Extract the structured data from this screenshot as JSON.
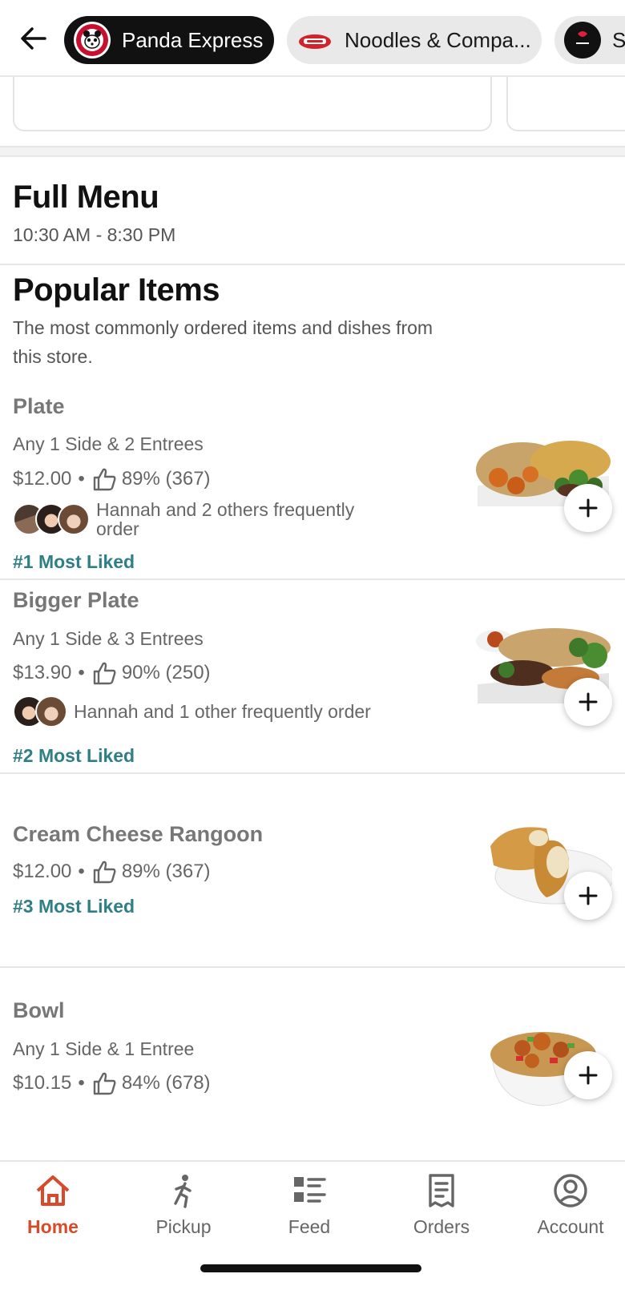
{
  "header": {
    "stores": [
      {
        "name": "Panda Express",
        "active": true
      },
      {
        "name": "Noodles & Compa..."
      },
      {
        "name": "S"
      }
    ]
  },
  "menu": {
    "title": "Full Menu",
    "hours": "10:30 AM - 8:30 PM"
  },
  "popular": {
    "title": "Popular Items",
    "subtitle_line1": "The most commonly ordered items and dishes from",
    "subtitle_line2": "this store.",
    "items": [
      {
        "name": "Plate",
        "desc": "Any 1 Side & 2 Entrees",
        "price": "$12.00",
        "dot": "•",
        "rating": "89% (367)",
        "social_line1": "Hannah and 2 others frequently",
        "social_line2": "order",
        "rank": "#1 Most Liked"
      },
      {
        "name": "Bigger Plate",
        "desc": "Any 1 Side & 3 Entrees",
        "price": "$13.90",
        "dot": "•",
        "rating": "90% (250)",
        "social_line1": "Hannah and 1 other frequently order",
        "rank": "#2 Most Liked"
      },
      {
        "name": "Cream Cheese Rangoon",
        "price": "$12.00",
        "dot": "•",
        "rating": "89% (367)",
        "rank": "#3 Most Liked"
      },
      {
        "name": "Bowl",
        "desc": "Any 1 Side & 1 Entree",
        "price": "$10.15",
        "dot": "•",
        "rating": "84% (678)"
      }
    ]
  },
  "bottom_nav": {
    "items": [
      {
        "label": "Home",
        "active": true
      },
      {
        "label": "Pickup"
      },
      {
        "label": "Feed"
      },
      {
        "label": "Orders"
      },
      {
        "label": "Account"
      }
    ]
  },
  "colors": {
    "accent": "#d94a2b",
    "rank": "#2f7f86",
    "chip_active_bg": "#111111"
  }
}
